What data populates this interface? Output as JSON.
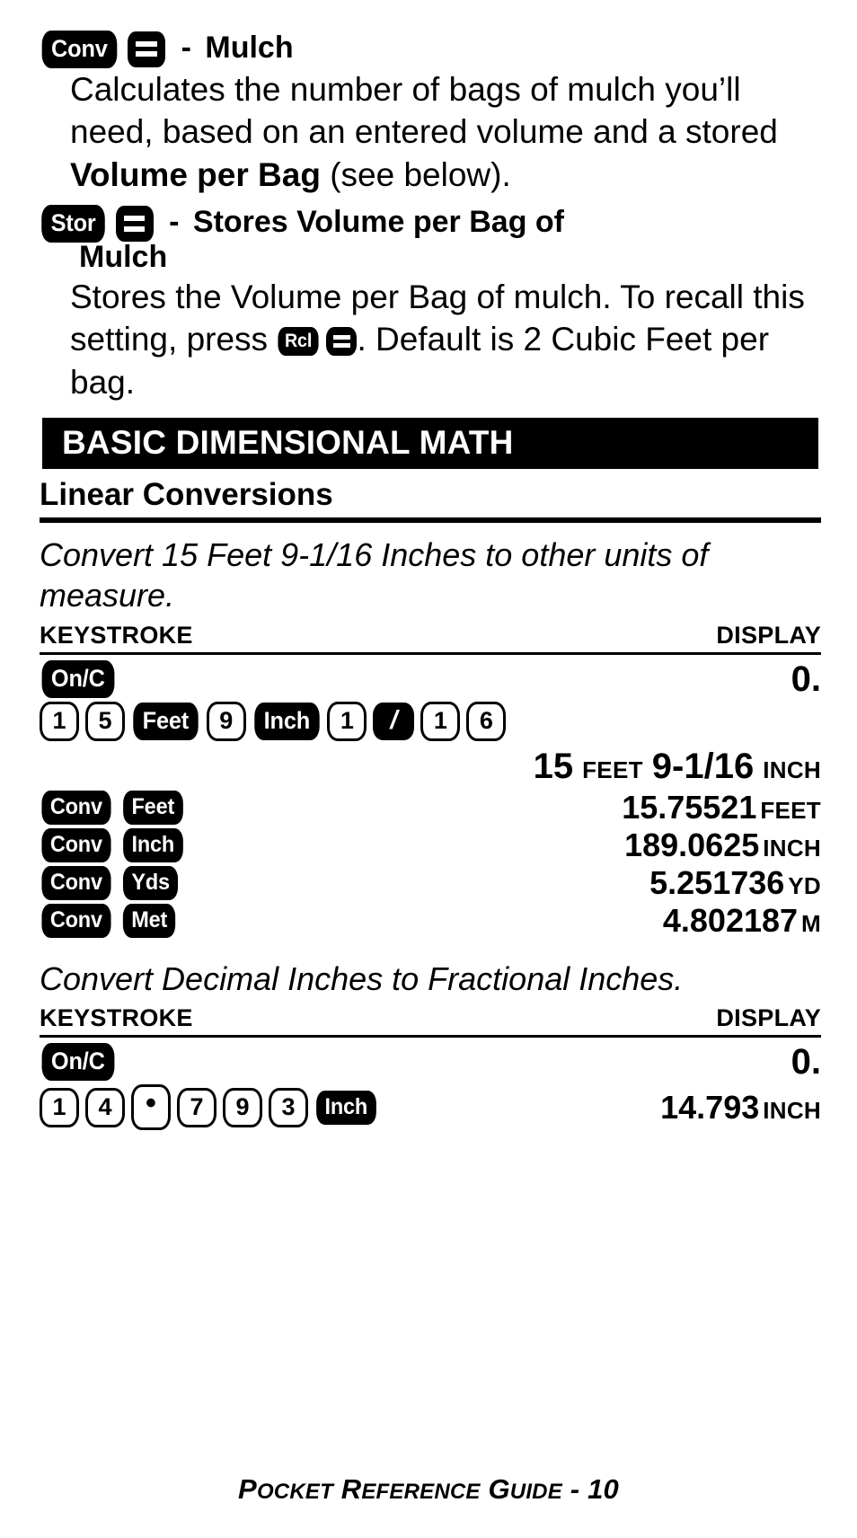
{
  "entries": [
    {
      "key_label": "Conv",
      "key2": "equals-icon",
      "dash": "-",
      "title": "Mulch",
      "body_pre": "Calculates the number of bags of mulch you’ll need, based on an entered volume and a stored ",
      "body_bold": "Volume per Bag",
      "body_post": " (see below)."
    },
    {
      "key_label": "Stor",
      "key2": "equals-icon",
      "dash": "-",
      "title": "Stores Volume per Bag of",
      "title_line2": "Mulch",
      "body_pre": "Stores the Volume per Bag of mulch. To recall this setting, press ",
      "inline_key1": "Rcl",
      "inline_key2": "equals-icon",
      "body_post": ". Default is 2 Cubic Feet per bag."
    }
  ],
  "banner": "BASIC DIMENSIONAL MATH",
  "subhead": "Linear Conversions",
  "sections": [
    {
      "task": "Convert 15 Feet 9-1/16 Inches to other units of measure.",
      "col_keystroke": "KEYSTROKE",
      "col_display": "DISPLAY",
      "rows": [
        {
          "keys": [
            {
              "type": "fn",
              "label": "On/C"
            }
          ],
          "display": "0.",
          "unit": ""
        },
        {
          "keys": [
            {
              "type": "num",
              "label": "1"
            },
            {
              "type": "num",
              "label": "5"
            },
            {
              "type": "fn",
              "label": "Feet"
            },
            {
              "type": "num",
              "label": "9"
            },
            {
              "type": "fn",
              "label": "Inch"
            },
            {
              "type": "num",
              "label": "1"
            },
            {
              "type": "div",
              "label": "/"
            },
            {
              "type": "num",
              "label": "1"
            },
            {
              "type": "num",
              "label": "6"
            }
          ],
          "display_wrap": true,
          "display_parts": [
            {
              "text": "15",
              "small": false
            },
            {
              "text": "FEET",
              "small": true
            },
            {
              "text": "9-1/16",
              "small": false
            },
            {
              "text": "INCH",
              "small": true
            }
          ]
        },
        {
          "keys": [
            {
              "type": "fn",
              "label": "Conv"
            },
            {
              "type": "fn",
              "label": "Feet"
            }
          ],
          "display": "15.75521",
          "unit": "FEET"
        },
        {
          "keys": [
            {
              "type": "fn",
              "label": "Conv"
            },
            {
              "type": "fn",
              "label": "Inch"
            }
          ],
          "display": "189.0625",
          "unit": "INCH"
        },
        {
          "keys": [
            {
              "type": "fn",
              "label": "Conv"
            },
            {
              "type": "fn",
              "label": "Yds"
            }
          ],
          "display": "5.251736",
          "unit": "YD"
        },
        {
          "keys": [
            {
              "type": "fn",
              "label": "Conv"
            },
            {
              "type": "fn",
              "label": "Met"
            }
          ],
          "display": "4.802187",
          "unit": "M"
        }
      ]
    },
    {
      "task": "Convert Decimal Inches to Fractional Inches.",
      "col_keystroke": "KEYSTROKE",
      "col_display": "DISPLAY",
      "rows": [
        {
          "keys": [
            {
              "type": "fn",
              "label": "On/C"
            }
          ],
          "display": "0.",
          "unit": ""
        },
        {
          "keys": [
            {
              "type": "num",
              "label": "1"
            },
            {
              "type": "num",
              "label": "4"
            },
            {
              "type": "num",
              "label": "•"
            },
            {
              "type": "num",
              "label": "7"
            },
            {
              "type": "num",
              "label": "9"
            },
            {
              "type": "num",
              "label": "3"
            },
            {
              "type": "fn",
              "label": "Inch"
            }
          ],
          "display": "14.793",
          "unit": "INCH"
        }
      ]
    }
  ],
  "footer": {
    "t1": "P",
    "t2": "OCKET",
    "t3": " R",
    "t4": "EFERENCE",
    "t5": " G",
    "t6": "UIDE",
    "t7": " - 10"
  },
  "colors": {
    "ink": "#000000",
    "paper": "#ffffff"
  }
}
